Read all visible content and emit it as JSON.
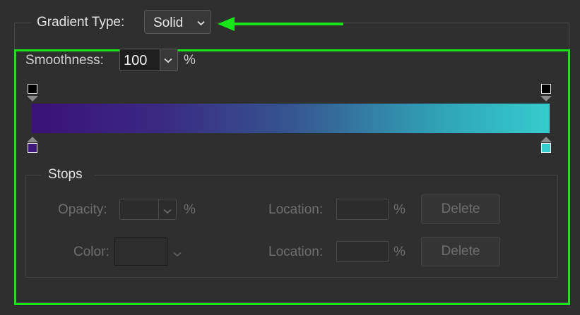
{
  "gradient_type": {
    "label": "Gradient Type:",
    "value": "Solid"
  },
  "smoothness": {
    "label": "Smoothness:",
    "value": "100",
    "unit": "%"
  },
  "gradient": {
    "start_color": "#3a1278",
    "end_color": "#34cccd",
    "opacity_stop_color_left": "#ffffff",
    "opacity_stop_color_right": "#ffffff",
    "color_stop_left": "#3d1a7a",
    "color_stop_right": "#34cccd"
  },
  "stops": {
    "title": "Stops",
    "opacity": {
      "label": "Opacity:",
      "value": "",
      "unit": "%",
      "location_label": "Location:",
      "location_value": "",
      "location_unit": "%",
      "delete_label": "Delete"
    },
    "color": {
      "label": "Color:",
      "location_label": "Location:",
      "location_value": "",
      "location_unit": "%",
      "delete_label": "Delete"
    }
  },
  "annotations": {
    "highlight_color": "#19e619",
    "arrow_color": "#19e619"
  }
}
